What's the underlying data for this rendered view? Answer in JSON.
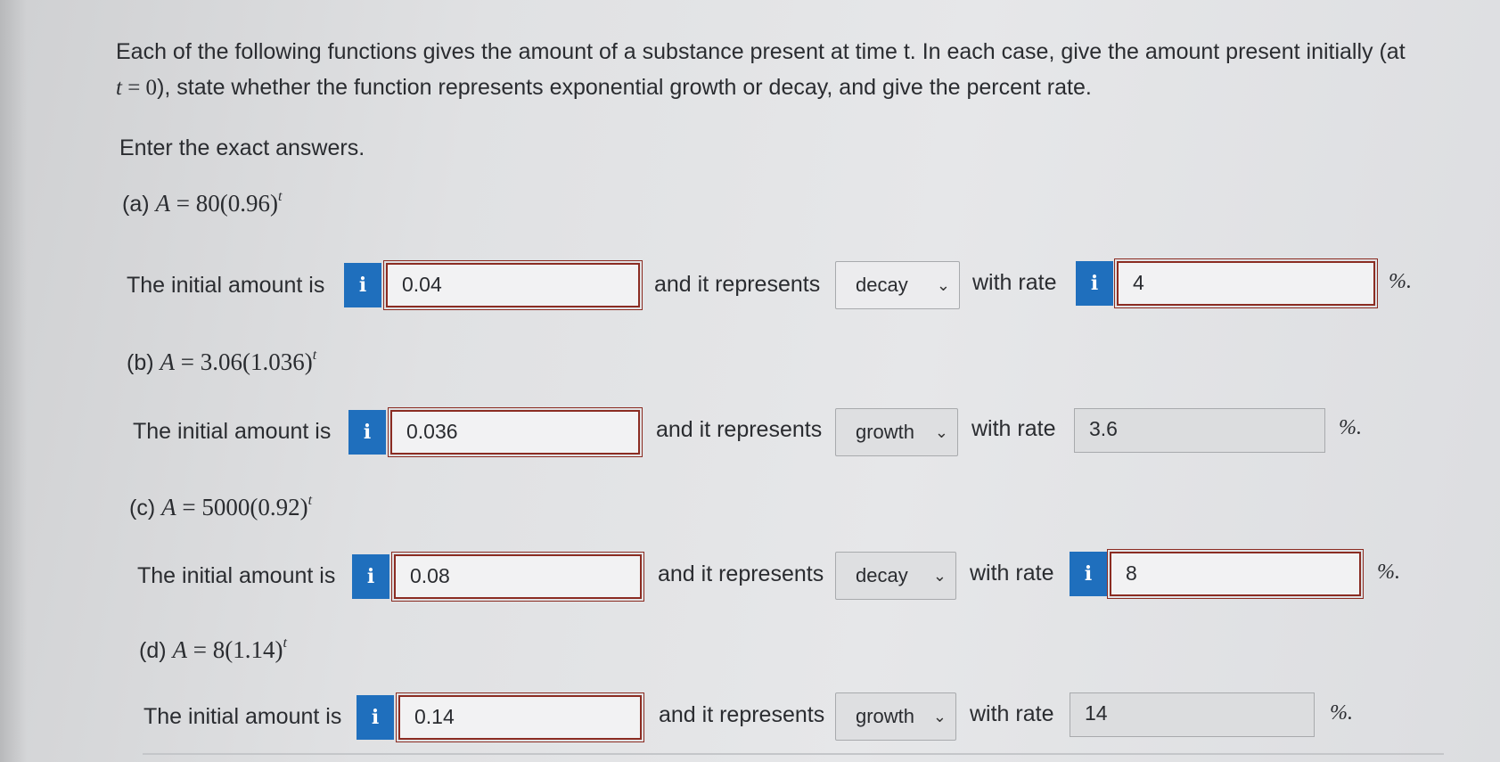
{
  "intro": {
    "line1": "Each of the following functions gives the amount of a substance present at time t. In each case, give the amount present initially (at",
    "line2_var": "t",
    "line2_eq": " = 0",
    "line2_rest": "), state whether the function represents exponential growth or decay, and give the percent rate."
  },
  "instruction": "Enter the exact answers.",
  "labels": {
    "initial": "The initial amount is",
    "represents": "and it represents",
    "with_rate": "with rate",
    "percent": "%."
  },
  "info_icon": "i",
  "problems": [
    {
      "label": "(a)",
      "lhs": "A",
      "eq": " = 80(0.96)",
      "sup": "t",
      "initial": "0.04",
      "type": "decay",
      "rate": "4",
      "rate_has_info": true
    },
    {
      "label": "(b)",
      "lhs": "A",
      "eq": " = 3.06(1.036)",
      "sup": "t",
      "initial": "0.036",
      "type": "growth",
      "rate": "3.6",
      "rate_has_info": false
    },
    {
      "label": "(c)",
      "lhs": "A",
      "eq": " = 5000(0.92)",
      "sup": "t",
      "initial": "0.08",
      "type": "decay",
      "rate": "8",
      "rate_has_info": true
    },
    {
      "label": "(d)",
      "lhs": "A",
      "eq": " = 8(1.14)",
      "sup": "t",
      "initial": "0.14",
      "type": "growth",
      "rate": "14",
      "rate_has_info": false
    }
  ],
  "colors": {
    "info_blue": "#1f6fbd",
    "incorrect_border": "#8b2c22"
  }
}
